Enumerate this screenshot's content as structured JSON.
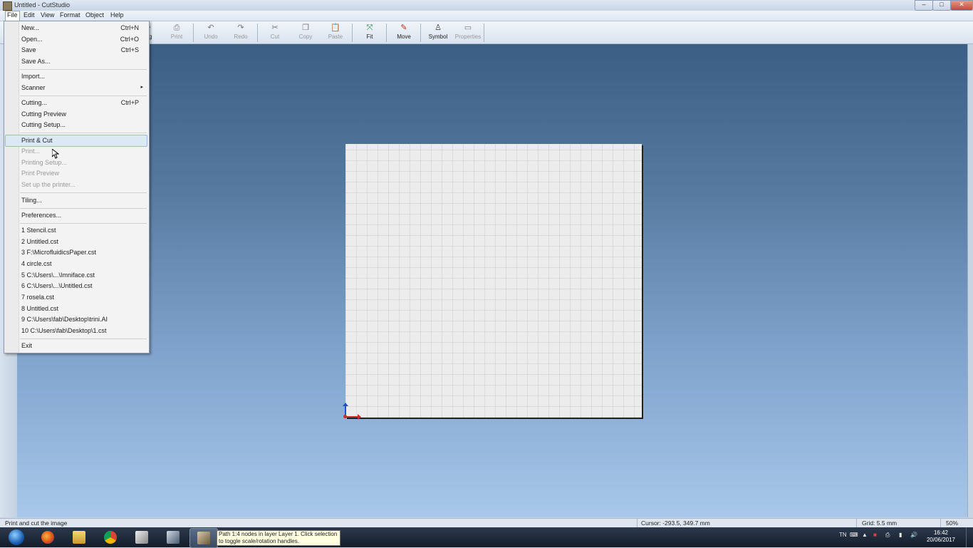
{
  "window": {
    "title": "Untitled - CutStudio",
    "controls": {
      "minimize": "–",
      "maximize": "□",
      "close": "✕"
    }
  },
  "menubar": [
    "File",
    "Edit",
    "View",
    "Format",
    "Object",
    "Help"
  ],
  "toolbar": {
    "partial_label": "ng",
    "items": [
      {
        "label": "Print",
        "icon": "print-icon",
        "enabled": false
      },
      {
        "label": "Undo",
        "icon": "undo-icon",
        "enabled": false
      },
      {
        "label": "Redo",
        "icon": "redo-icon",
        "enabled": false
      },
      {
        "label": "Cut",
        "icon": "cut-icon",
        "enabled": false
      },
      {
        "label": "Copy",
        "icon": "copy-icon",
        "enabled": false
      },
      {
        "label": "Paste",
        "icon": "paste-icon",
        "enabled": false
      },
      {
        "label": "Fit",
        "icon": "fit-icon",
        "enabled": true
      },
      {
        "label": "Move",
        "icon": "move-icon",
        "enabled": true
      },
      {
        "label": "Symbol",
        "icon": "symbol-icon",
        "enabled": true
      },
      {
        "label": "Properties",
        "icon": "properties-icon",
        "enabled": false
      }
    ]
  },
  "file_menu": {
    "items": [
      {
        "label": "New...",
        "shortcut": "Ctrl+N"
      },
      {
        "label": "Open...",
        "shortcut": "Ctrl+O"
      },
      {
        "label": "Save",
        "shortcut": "Ctrl+S"
      },
      {
        "label": "Save As...",
        "shortcut": ""
      },
      {
        "label": "Import...",
        "shortcut": ""
      },
      {
        "label": "Scanner",
        "shortcut": "",
        "submenu": true
      },
      {
        "label": "Cutting...",
        "shortcut": "Ctrl+P"
      },
      {
        "label": "Cutting Preview",
        "shortcut": ""
      },
      {
        "label": "Cutting Setup...",
        "shortcut": ""
      },
      {
        "label": "Print & Cut",
        "shortcut": "",
        "highlighted": true
      },
      {
        "label": "Print...",
        "shortcut": "",
        "disabled": true
      },
      {
        "label": "Printing Setup...",
        "shortcut": "",
        "disabled": true
      },
      {
        "label": "Print Preview",
        "shortcut": "",
        "disabled": true
      },
      {
        "label": "Set up the printer...",
        "shortcut": "",
        "disabled": true
      },
      {
        "label": "Tiling...",
        "shortcut": ""
      },
      {
        "label": "Preferences...",
        "shortcut": ""
      },
      {
        "label": "1 Stencil.cst",
        "shortcut": ""
      },
      {
        "label": "2 Untitled.cst",
        "shortcut": ""
      },
      {
        "label": "3 F:\\MicrofluidicsPaper.cst",
        "shortcut": ""
      },
      {
        "label": "4 circle.cst",
        "shortcut": ""
      },
      {
        "label": "5 C:\\Users\\...\\Imniface.cst",
        "shortcut": ""
      },
      {
        "label": "6 C:\\Users\\...\\Untitled.cst",
        "shortcut": ""
      },
      {
        "label": "7 rosela.cst",
        "shortcut": ""
      },
      {
        "label": "8 Untitled.cst",
        "shortcut": ""
      },
      {
        "label": "9 C:\\Users\\fab\\Desktop\\trini.AI",
        "shortcut": ""
      },
      {
        "label": "10 C:\\Users\\fab\\Desktop\\1.cst",
        "shortcut": ""
      },
      {
        "label": "Exit",
        "shortcut": ""
      }
    ],
    "submenu_arrow": "▸"
  },
  "statusbar": {
    "message": "Print and cut the image",
    "cursor": "Cursor: -293.5, 349.7 mm",
    "grid": "Grid: 5.5 mm",
    "zoom": "50%"
  },
  "taskbar": {
    "tooltip": "Path 1:4 nodes in layer Layer 1. Click selection to toggle scale/rotation handles.",
    "tray_lang": "TN",
    "time": "16:42",
    "date": "20/06/2017",
    "apps": [
      "start-orb",
      "firefox-icon",
      "file-explorer-icon",
      "chrome-icon",
      "app-icon",
      "app-icon-2",
      "cutstudio-icon"
    ]
  },
  "colors": {
    "workspace_top": "#3b5e84",
    "workspace_bottom": "#a8c7ea",
    "menu_highlight": "#dde8f5",
    "axis_y": "#2050c8",
    "axis_x": "#c83020"
  }
}
